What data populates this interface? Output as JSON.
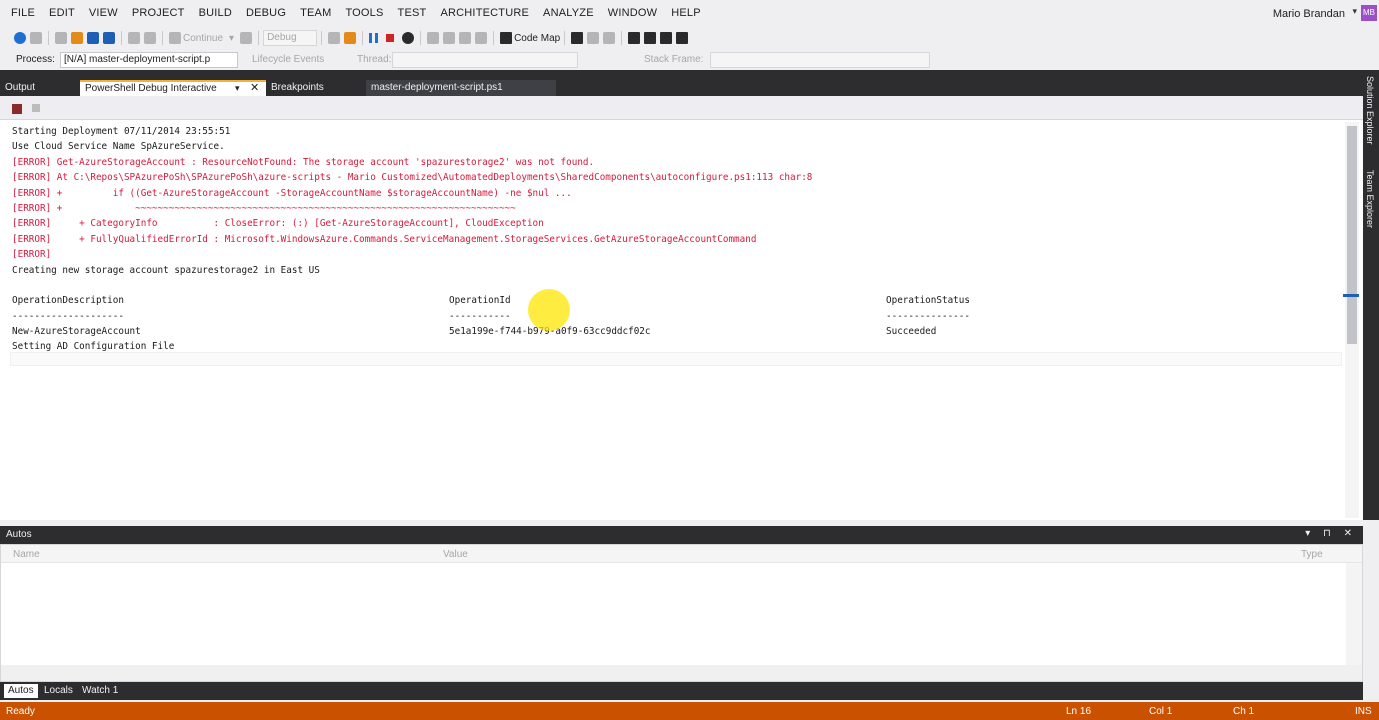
{
  "menu": [
    "FILE",
    "EDIT",
    "VIEW",
    "PROJECT",
    "BUILD",
    "DEBUG",
    "TEAM",
    "TOOLS",
    "TEST",
    "ARCHITECTURE",
    "ANALYZE",
    "WINDOW",
    "HELP"
  ],
  "user": {
    "name": "Mario Brandan",
    "initials": "MB"
  },
  "toolbar": {
    "continue_label": "Continue",
    "debug_select": "Debug",
    "code_map_label": "Code Map"
  },
  "debug_location": {
    "process_label": "Process:",
    "process_value": "[N/A] master-deployment-script.p",
    "lifecycle_label": "Lifecycle Events",
    "thread_label": "Thread:",
    "stack_frame_label": "Stack Frame:"
  },
  "tabs": {
    "output": "Output",
    "ps_debug": "PowerShell Debug Interactive",
    "ps_debug_pin": "▾",
    "ps_debug_close": "✕",
    "breakpoints": "Breakpoints",
    "script": "master-deployment-script.ps1"
  },
  "side_tabs": {
    "solution_explorer": "Solution Explorer",
    "team_explorer": "Team Explorer"
  },
  "console": {
    "lines": [
      {
        "kind": "normal",
        "text": "Starting Deployment 07/11/2014 23:55:51"
      },
      {
        "kind": "normal",
        "text": "Use Cloud Service Name SpAzureService."
      },
      {
        "kind": "err",
        "text": "[ERROR] Get-AzureStorageAccount : ResourceNotFound: The storage account 'spazurestorage2' was not found."
      },
      {
        "kind": "err",
        "text": "[ERROR] At C:\\Repos\\SPAzurePoSh\\SPAzurePoSh\\azure-scripts - Mario Customized\\AutomatedDeployments\\SharedComponents\\autoconfigure.ps1:113 char:8"
      },
      {
        "kind": "err",
        "text": "[ERROR] +         if ((Get-AzureStorageAccount -StorageAccountName $storageAccountName) -ne $nul ..."
      },
      {
        "kind": "err",
        "text": "[ERROR] +             ~~~~~~~~~~~~~~~~~~~~~~~~~~~~~~~~~~~~~~~~~~~~~~~~~~~~~~~~~~~~~~~~~~~~"
      },
      {
        "kind": "err",
        "text": "[ERROR]     + CategoryInfo          : CloseError: (:) [Get-AzureStorageAccount], CloudException"
      },
      {
        "kind": "err",
        "text": "[ERROR]     + FullyQualifiedErrorId : Microsoft.WindowsAzure.Commands.ServiceManagement.StorageServices.GetAzureStorageAccountCommand"
      },
      {
        "kind": "err",
        "text": "[ERROR]"
      },
      {
        "kind": "normal",
        "text": "Creating new storage account spazurestorage2 in East US"
      },
      {
        "kind": "normal",
        "text": ""
      }
    ],
    "table": {
      "headers": [
        "OperationDescription",
        "OperationId",
        "OperationStatus"
      ],
      "underlines": [
        "--------------------",
        "-----------",
        "---------------"
      ],
      "row": [
        "New-AzureStorageAccount",
        "5e1a199e-f744-b979-a0f9-63cc9ddcf02c",
        "Succeeded"
      ]
    },
    "after": "Setting AD Configuration File"
  },
  "autos": {
    "title": "Autos",
    "controls": "▾ ⊓ ✕",
    "columns": [
      "Name",
      "Value",
      "Type"
    ]
  },
  "bottom_tabs": [
    "Autos",
    "Locals",
    "Watch 1"
  ],
  "status": {
    "ready": "Ready",
    "ln": "Ln 16",
    "col": "Col 1",
    "ch": "Ch 1",
    "ins": "INS"
  },
  "colors": {
    "status_bar": "#ca5100",
    "active_tab_accent": "#eeb43a",
    "error_text": "#d61a3c",
    "cursor_highlight": "#ffe600"
  }
}
